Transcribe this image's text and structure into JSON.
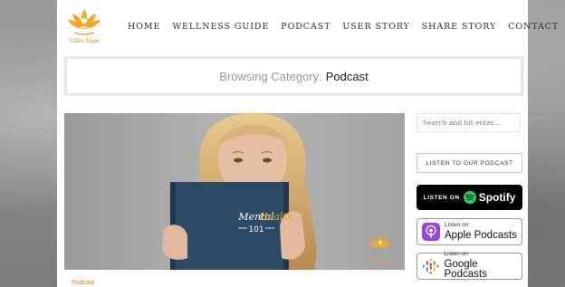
{
  "site": {
    "logo_text": "Calm Sage",
    "colors": {
      "accent": "#e07b00",
      "logo": "#f5a623"
    }
  },
  "nav": {
    "items": [
      "HOME",
      "WELLNESS GUIDE",
      "PODCAST",
      "USER STORY",
      "SHARE STORY",
      "CONTACT"
    ]
  },
  "category_header": {
    "prefix": "Browsing Category:",
    "name": "Podcast"
  },
  "feature": {
    "book_title_line1": "Mental",
    "book_title_line2": "Health",
    "book_number": "101",
    "logo_text": "Calm Sage",
    "category_tag": "Podcast"
  },
  "sidebar": {
    "search_placeholder": "Search and hit enter...",
    "listen_title": "LISTEN TO OUR PODCAST",
    "spotify": {
      "prefix": "LISTEN ON",
      "name": "Spotify",
      "icon": "spotify-icon"
    },
    "apple": {
      "small": "Listen on",
      "big": "Apple Podcasts",
      "icon": "apple-podcasts-icon"
    },
    "google": {
      "small": "Listen on",
      "big": "Google Podcasts",
      "icon": "google-podcasts-icon"
    }
  }
}
